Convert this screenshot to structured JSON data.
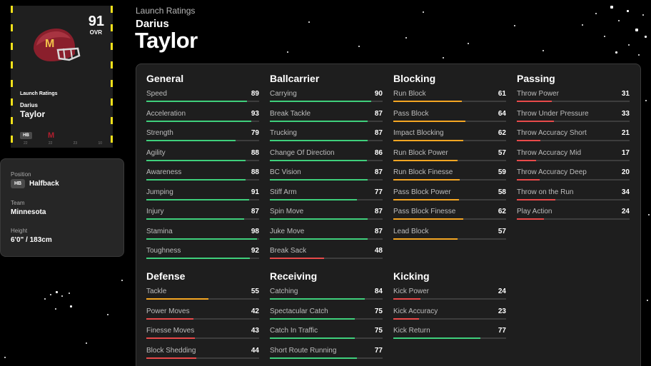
{
  "colors": {
    "bar_high": "#3fd07c",
    "bar_mid": "#f5a623",
    "bar_low": "#e84a4a",
    "card_accent": "#f3e11b",
    "team_maroon": "#8a1f2c"
  },
  "card": {
    "ovr": "91",
    "ovr_label": "OVR",
    "ratings_label": "Launch Ratings",
    "first_name": "Darius",
    "last_name": "Taylor",
    "position": "HB",
    "team_logo": "M",
    "helmet_icon": "football-helmet-icon",
    "bottom_values": [
      "22",
      "22",
      "23",
      "10"
    ]
  },
  "info": {
    "position_label": "Position",
    "position_badge": "HB",
    "position_value": "Halfback",
    "team_label": "Team",
    "team_value": "Minnesota",
    "height_label": "Height",
    "height_value": "6'0\" / 183cm"
  },
  "header": {
    "subtitle": "Launch Ratings",
    "first_name": "Darius",
    "last_name": "Taylor"
  },
  "groups": [
    {
      "title": "General",
      "stats": [
        {
          "name": "Speed",
          "value": 89
        },
        {
          "name": "Acceleration",
          "value": 93
        },
        {
          "name": "Strength",
          "value": 79
        },
        {
          "name": "Agility",
          "value": 88
        },
        {
          "name": "Awareness",
          "value": 88
        },
        {
          "name": "Jumping",
          "value": 91
        },
        {
          "name": "Injury",
          "value": 87
        },
        {
          "name": "Stamina",
          "value": 98
        },
        {
          "name": "Toughness",
          "value": 92
        }
      ]
    },
    {
      "title": "Ballcarrier",
      "stats": [
        {
          "name": "Carrying",
          "value": 90
        },
        {
          "name": "Break Tackle",
          "value": 87
        },
        {
          "name": "Trucking",
          "value": 87
        },
        {
          "name": "Change Of Direction",
          "value": 86
        },
        {
          "name": "BC Vision",
          "value": 87
        },
        {
          "name": "Stiff Arm",
          "value": 77
        },
        {
          "name": "Spin Move",
          "value": 87
        },
        {
          "name": "Juke Move",
          "value": 87
        },
        {
          "name": "Break Sack",
          "value": 48
        }
      ]
    },
    {
      "title": "Blocking",
      "stats": [
        {
          "name": "Run Block",
          "value": 61
        },
        {
          "name": "Pass Block",
          "value": 64
        },
        {
          "name": "Impact Blocking",
          "value": 62
        },
        {
          "name": "Run Block Power",
          "value": 57
        },
        {
          "name": "Run Block Finesse",
          "value": 59
        },
        {
          "name": "Pass Block Power",
          "value": 58
        },
        {
          "name": "Pass Block Finesse",
          "value": 62
        },
        {
          "name": "Lead Block",
          "value": 57
        }
      ]
    },
    {
      "title": "Passing",
      "stats": [
        {
          "name": "Throw Power",
          "value": 31
        },
        {
          "name": "Throw Under Pressure",
          "value": 33
        },
        {
          "name": "Throw Accuracy Short",
          "value": 21
        },
        {
          "name": "Throw Accuracy Mid",
          "value": 17
        },
        {
          "name": "Throw Accuracy Deep",
          "value": 20
        },
        {
          "name": "Throw on the Run",
          "value": 34
        },
        {
          "name": "Play Action",
          "value": 24
        }
      ]
    },
    {
      "title": "Defense",
      "stats": [
        {
          "name": "Tackle",
          "value": 55
        },
        {
          "name": "Power Moves",
          "value": 42
        },
        {
          "name": "Finesse Moves",
          "value": 43
        },
        {
          "name": "Block Shedding",
          "value": 44
        }
      ]
    },
    {
      "title": "Receiving",
      "stats": [
        {
          "name": "Catching",
          "value": 84
        },
        {
          "name": "Spectacular Catch",
          "value": 75
        },
        {
          "name": "Catch In Traffic",
          "value": 75
        },
        {
          "name": "Short Route Running",
          "value": 77
        }
      ]
    },
    {
      "title": "Kicking",
      "stats": [
        {
          "name": "Kick Power",
          "value": 24
        },
        {
          "name": "Kick Accuracy",
          "value": 23
        },
        {
          "name": "Kick Return",
          "value": 77
        }
      ]
    }
  ]
}
